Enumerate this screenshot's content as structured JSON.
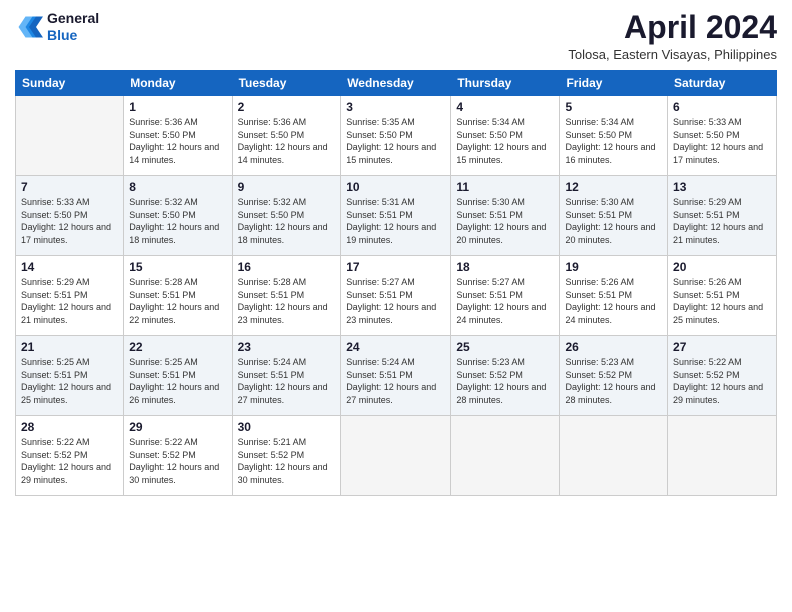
{
  "header": {
    "logo_line1": "General",
    "logo_line2": "Blue",
    "month": "April 2024",
    "location": "Tolosa, Eastern Visayas, Philippines"
  },
  "days_of_week": [
    "Sunday",
    "Monday",
    "Tuesday",
    "Wednesday",
    "Thursday",
    "Friday",
    "Saturday"
  ],
  "weeks": [
    [
      {
        "day": "",
        "empty": true
      },
      {
        "day": "1",
        "sunrise": "5:36 AM",
        "sunset": "5:50 PM",
        "daylight": "12 hours and 14 minutes."
      },
      {
        "day": "2",
        "sunrise": "5:36 AM",
        "sunset": "5:50 PM",
        "daylight": "12 hours and 14 minutes."
      },
      {
        "day": "3",
        "sunrise": "5:35 AM",
        "sunset": "5:50 PM",
        "daylight": "12 hours and 15 minutes."
      },
      {
        "day": "4",
        "sunrise": "5:34 AM",
        "sunset": "5:50 PM",
        "daylight": "12 hours and 15 minutes."
      },
      {
        "day": "5",
        "sunrise": "5:34 AM",
        "sunset": "5:50 PM",
        "daylight": "12 hours and 16 minutes."
      },
      {
        "day": "6",
        "sunrise": "5:33 AM",
        "sunset": "5:50 PM",
        "daylight": "12 hours and 17 minutes."
      }
    ],
    [
      {
        "day": "7",
        "sunrise": "5:33 AM",
        "sunset": "5:50 PM",
        "daylight": "12 hours and 17 minutes."
      },
      {
        "day": "8",
        "sunrise": "5:32 AM",
        "sunset": "5:50 PM",
        "daylight": "12 hours and 18 minutes."
      },
      {
        "day": "9",
        "sunrise": "5:32 AM",
        "sunset": "5:50 PM",
        "daylight": "12 hours and 18 minutes."
      },
      {
        "day": "10",
        "sunrise": "5:31 AM",
        "sunset": "5:51 PM",
        "daylight": "12 hours and 19 minutes."
      },
      {
        "day": "11",
        "sunrise": "5:30 AM",
        "sunset": "5:51 PM",
        "daylight": "12 hours and 20 minutes."
      },
      {
        "day": "12",
        "sunrise": "5:30 AM",
        "sunset": "5:51 PM",
        "daylight": "12 hours and 20 minutes."
      },
      {
        "day": "13",
        "sunrise": "5:29 AM",
        "sunset": "5:51 PM",
        "daylight": "12 hours and 21 minutes."
      }
    ],
    [
      {
        "day": "14",
        "sunrise": "5:29 AM",
        "sunset": "5:51 PM",
        "daylight": "12 hours and 21 minutes."
      },
      {
        "day": "15",
        "sunrise": "5:28 AM",
        "sunset": "5:51 PM",
        "daylight": "12 hours and 22 minutes."
      },
      {
        "day": "16",
        "sunrise": "5:28 AM",
        "sunset": "5:51 PM",
        "daylight": "12 hours and 23 minutes."
      },
      {
        "day": "17",
        "sunrise": "5:27 AM",
        "sunset": "5:51 PM",
        "daylight": "12 hours and 23 minutes."
      },
      {
        "day": "18",
        "sunrise": "5:27 AM",
        "sunset": "5:51 PM",
        "daylight": "12 hours and 24 minutes."
      },
      {
        "day": "19",
        "sunrise": "5:26 AM",
        "sunset": "5:51 PM",
        "daylight": "12 hours and 24 minutes."
      },
      {
        "day": "20",
        "sunrise": "5:26 AM",
        "sunset": "5:51 PM",
        "daylight": "12 hours and 25 minutes."
      }
    ],
    [
      {
        "day": "21",
        "sunrise": "5:25 AM",
        "sunset": "5:51 PM",
        "daylight": "12 hours and 25 minutes."
      },
      {
        "day": "22",
        "sunrise": "5:25 AM",
        "sunset": "5:51 PM",
        "daylight": "12 hours and 26 minutes."
      },
      {
        "day": "23",
        "sunrise": "5:24 AM",
        "sunset": "5:51 PM",
        "daylight": "12 hours and 27 minutes."
      },
      {
        "day": "24",
        "sunrise": "5:24 AM",
        "sunset": "5:51 PM",
        "daylight": "12 hours and 27 minutes."
      },
      {
        "day": "25",
        "sunrise": "5:23 AM",
        "sunset": "5:52 PM",
        "daylight": "12 hours and 28 minutes."
      },
      {
        "day": "26",
        "sunrise": "5:23 AM",
        "sunset": "5:52 PM",
        "daylight": "12 hours and 28 minutes."
      },
      {
        "day": "27",
        "sunrise": "5:22 AM",
        "sunset": "5:52 PM",
        "daylight": "12 hours and 29 minutes."
      }
    ],
    [
      {
        "day": "28",
        "sunrise": "5:22 AM",
        "sunset": "5:52 PM",
        "daylight": "12 hours and 29 minutes."
      },
      {
        "day": "29",
        "sunrise": "5:22 AM",
        "sunset": "5:52 PM",
        "daylight": "12 hours and 30 minutes."
      },
      {
        "day": "30",
        "sunrise": "5:21 AM",
        "sunset": "5:52 PM",
        "daylight": "12 hours and 30 minutes."
      },
      {
        "day": "",
        "empty": true
      },
      {
        "day": "",
        "empty": true
      },
      {
        "day": "",
        "empty": true
      },
      {
        "day": "",
        "empty": true
      }
    ]
  ]
}
